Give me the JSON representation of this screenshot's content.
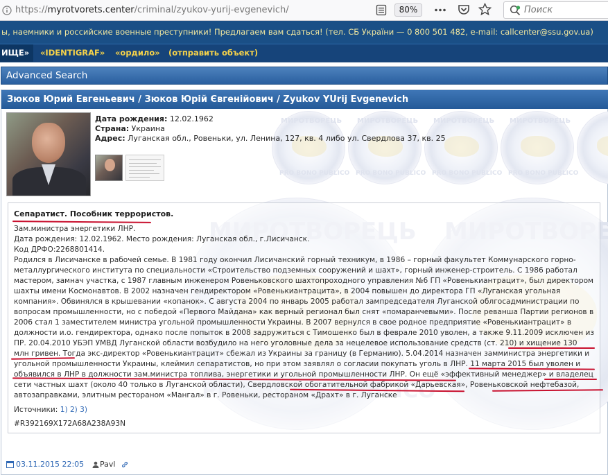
{
  "browser": {
    "url_scheme": "https://",
    "url_host": "myrotvorets.center",
    "url_path": "/criminal/zyukov-yurij-evgenevich/",
    "zoom": "80%",
    "search_placeholder": "Поиск"
  },
  "site": {
    "ticker": "ы, наемники и российские военные преступники! Предлагаем вам сдаться! (тел. СБ України — 0 800 501 482, e-mail: callcenter@ssu.gov.ua)",
    "menu": [
      "ИЩЕ»",
      "«IDENTIGRAF»",
      "«ордило»",
      "(отправить объект)"
    ],
    "advanced_search": "Advanced Search"
  },
  "profile": {
    "title": "Зюков Юрий Евгеньевич / Зюков Юрій Євгенійович / Zyukov YUrij Evgenevich",
    "birth_label": "Дата рождения:",
    "birth_value": "12.02.1962",
    "country_label": "Страна:",
    "country_value": "Украина",
    "address_label": "Адрес:",
    "address_value": "Луганская обл., Ровеньки, ул. Ленина, 127, кв. 4 либо ул. Свердлова 37, кв. 25",
    "watermark_top": "МИРОТВОРЕЦЬ",
    "watermark_bottom": "PRO BONO PUBLICO"
  },
  "body": {
    "headline": "Сепаратист. Пособник террористов.",
    "lines": [
      "Зам.министра энергетики ЛНР.",
      "Дата рождения: 12.02.1962.  Место рождения: Луганская обл., г.Лисичанск.",
      "Код ДРФО:2268801414.",
      "Родился в Лисичанске в рабочей семье. В 1981 году окончил Лисичанский горный техникум, в 1986 – горный факультет Коммунарского горно-",
      "металлургического института по специальности «Строительство подземных сооружений и шахт», горный инженер-строитель. С 1986 работал",
      "мастером, замнач участка, с 1987 главным инженером Ровеньковского шахтопроходного управления №6 ГП «Ровенькиантрацит», был директором",
      "шахты имени Космонавтов. В 2002 назначен гендиректором «Ровенькиантрацита», в 2004 повышен до директора ГП «Луганская угольная",
      "компания». Обвинялся в крышевании «копанок». С августа 2004 по январь 2005 работал зампредседателя Луганской облгосадминистрации по",
      "вопросам промышленности, но с победой «Первого Майдана» как верный регионал был снят «помаранчевыми». После реванша Партии регионов в",
      "2006 стал 1 заместителем министра угольной промышленности Украины. В 2007 вернулся в свое родное предприятие «Ровенькиантрацит» в",
      "должности и.о. гендиректора, однако после попыток в 2008 задружиться с Тимошенко был в феврале 2010 уволен, а также 9.11.2009 исключен из",
      "ПР. 20.04.2010 УБЭП УМВД Луганской области возбудило на него уголовные дела за нецелевое использование средств (ст. 210) и хищение 130",
      "млн гривен. Тогда экс-директор «Ровенькиантрацит» сбежал из Украины за границу (в Германию). 5.04.2014 назначен замминистра энергетики и",
      "угольной промышленности Украины, клеймил сепаратистов, но при этом заявлял о согласии покупать уголь в ЛНР. 11 марта 2015 был уволен и",
      "объявился в ЛНР в должности зам.министра топлива, энергетики и угольной промышленности ЛНР. Он ещё «эффективный менеджер» и владелец",
      "сети частных шахт (около 40 только в Луганской области), Свердловской обогатительной фабрикой «Дарьевская», Ровеньковской нефтебазой,",
      "автозаправками, элитным рестораном «Мангал» в г. Ровеньки, рестораном «Драхт» в г. Луганске"
    ],
    "sources_label": "Источники:",
    "sources": "1) 2) 3)",
    "hash": "#R392169X172A68A238A93N"
  },
  "footer": {
    "date": "03.11.2015 22:05",
    "author": "Pavl"
  },
  "colors": {
    "accent_blue": "#2a5f9f",
    "ticker_text": "#f2e8a0",
    "menu_text": "#f5d24a",
    "underline_red": "#c8102e",
    "link": "#2f68b5"
  }
}
